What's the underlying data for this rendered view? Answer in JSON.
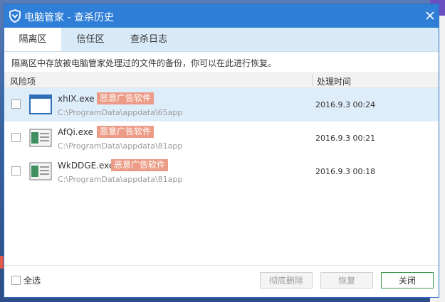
{
  "window": {
    "title": "电脑管家 - 查杀历史"
  },
  "tabs": [
    {
      "label": "隔离区",
      "active": true
    },
    {
      "label": "信任区",
      "active": false
    },
    {
      "label": "查杀日志",
      "active": false
    }
  ],
  "description": "隔离区中存放被电脑管家处理过的文件的备份，你可以在此进行恢复。",
  "table": {
    "headers": {
      "risk": "风险项",
      "time": "处理时间"
    },
    "rows": [
      {
        "name": "xhIX.exe",
        "tag": "恶意广告软件",
        "path": "C:\\ProgramData\\appdata\\65app",
        "time": "2016.9.3 00:24",
        "selected": true
      },
      {
        "name": "AfQi.exe",
        "tag": "恶意广告软件",
        "path": "C:\\ProgramData\\appdata\\81app",
        "time": "2016.9.3 00:21",
        "selected": false
      },
      {
        "name": "WkDDGE.exe",
        "tag": "恶意广告软件",
        "path": "C:\\ProgramData\\appdata\\81app",
        "time": "2016.9.3 00:18",
        "selected": false
      }
    ]
  },
  "footer": {
    "select_all": "全选",
    "delete_label": "彻底删除",
    "restore_label": "恢复",
    "close_label": "关闭"
  },
  "colors": {
    "titlebar": "#2f7fd8",
    "tab_bar": "#d8e9f7",
    "tag": "#ec9c86",
    "selected_row": "#deedfa",
    "close_button_border": "#3f9a4a"
  },
  "icons": {
    "title": "shield-icon",
    "close": "close-icon",
    "file": "window-file-icon"
  }
}
